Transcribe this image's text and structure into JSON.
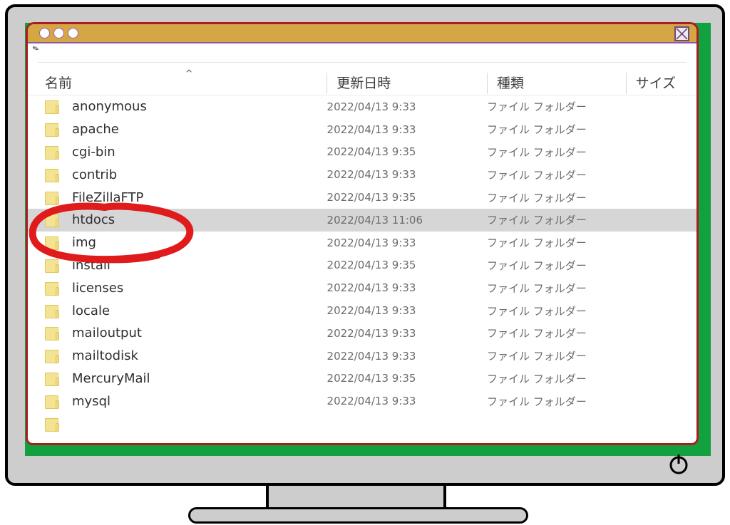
{
  "device": {
    "type": "desktop-monitor",
    "bezel_color": "#cdcdcd",
    "screen_color": "#12a13f",
    "power_icon": "power-icon"
  },
  "window": {
    "border_color": "#a81f23",
    "titlebar_color": "#d5a644",
    "titlebar_accent": "#8e56a8",
    "traffic_lights": [
      "circle-1",
      "circle-2",
      "circle-3"
    ],
    "close_icon": "close-window-icon",
    "toolbar_mark": "✎"
  },
  "columns": {
    "name": "名前",
    "date": "更新日時",
    "type": "種類",
    "size": "サイズ",
    "sort_indicator": "⌃"
  },
  "annotation": {
    "shape": "red-ellipse-circle",
    "color": "#e01b1b",
    "target_row": "htdocs"
  },
  "files": [
    {
      "name": "anonymous",
      "date": "2022/04/13 9:33",
      "type": "ファイル フォルダー",
      "size": "",
      "selected": false
    },
    {
      "name": "apache",
      "date": "2022/04/13 9:33",
      "type": "ファイル フォルダー",
      "size": "",
      "selected": false
    },
    {
      "name": "cgi-bin",
      "date": "2022/04/13 9:35",
      "type": "ファイル フォルダー",
      "size": "",
      "selected": false
    },
    {
      "name": "contrib",
      "date": "2022/04/13 9:33",
      "type": "ファイル フォルダー",
      "size": "",
      "selected": false
    },
    {
      "name": "FileZillaFTP",
      "date": "2022/04/13 9:35",
      "type": "ファイル フォルダー",
      "size": "",
      "selected": false
    },
    {
      "name": "htdocs",
      "date": "2022/04/13 11:06",
      "type": "ファイル フォルダー",
      "size": "",
      "selected": true
    },
    {
      "name": "img",
      "date": "2022/04/13 9:33",
      "type": "ファイル フォルダー",
      "size": "",
      "selected": false
    },
    {
      "name": "install",
      "date": "2022/04/13 9:35",
      "type": "ファイル フォルダー",
      "size": "",
      "selected": false
    },
    {
      "name": "licenses",
      "date": "2022/04/13 9:33",
      "type": "ファイル フォルダー",
      "size": "",
      "selected": false
    },
    {
      "name": "locale",
      "date": "2022/04/13 9:33",
      "type": "ファイル フォルダー",
      "size": "",
      "selected": false
    },
    {
      "name": "mailoutput",
      "date": "2022/04/13 9:33",
      "type": "ファイル フォルダー",
      "size": "",
      "selected": false
    },
    {
      "name": "mailtodisk",
      "date": "2022/04/13 9:33",
      "type": "ファイル フォルダー",
      "size": "",
      "selected": false
    },
    {
      "name": "MercuryMail",
      "date": "2022/04/13 9:35",
      "type": "ファイル フォルダー",
      "size": "",
      "selected": false
    },
    {
      "name": "mysql",
      "date": "2022/04/13 9:33",
      "type": "ファイル フォルダー",
      "size": "",
      "selected": false
    },
    {
      "name": "",
      "date": "",
      "type": "",
      "size": "",
      "selected": false
    }
  ]
}
